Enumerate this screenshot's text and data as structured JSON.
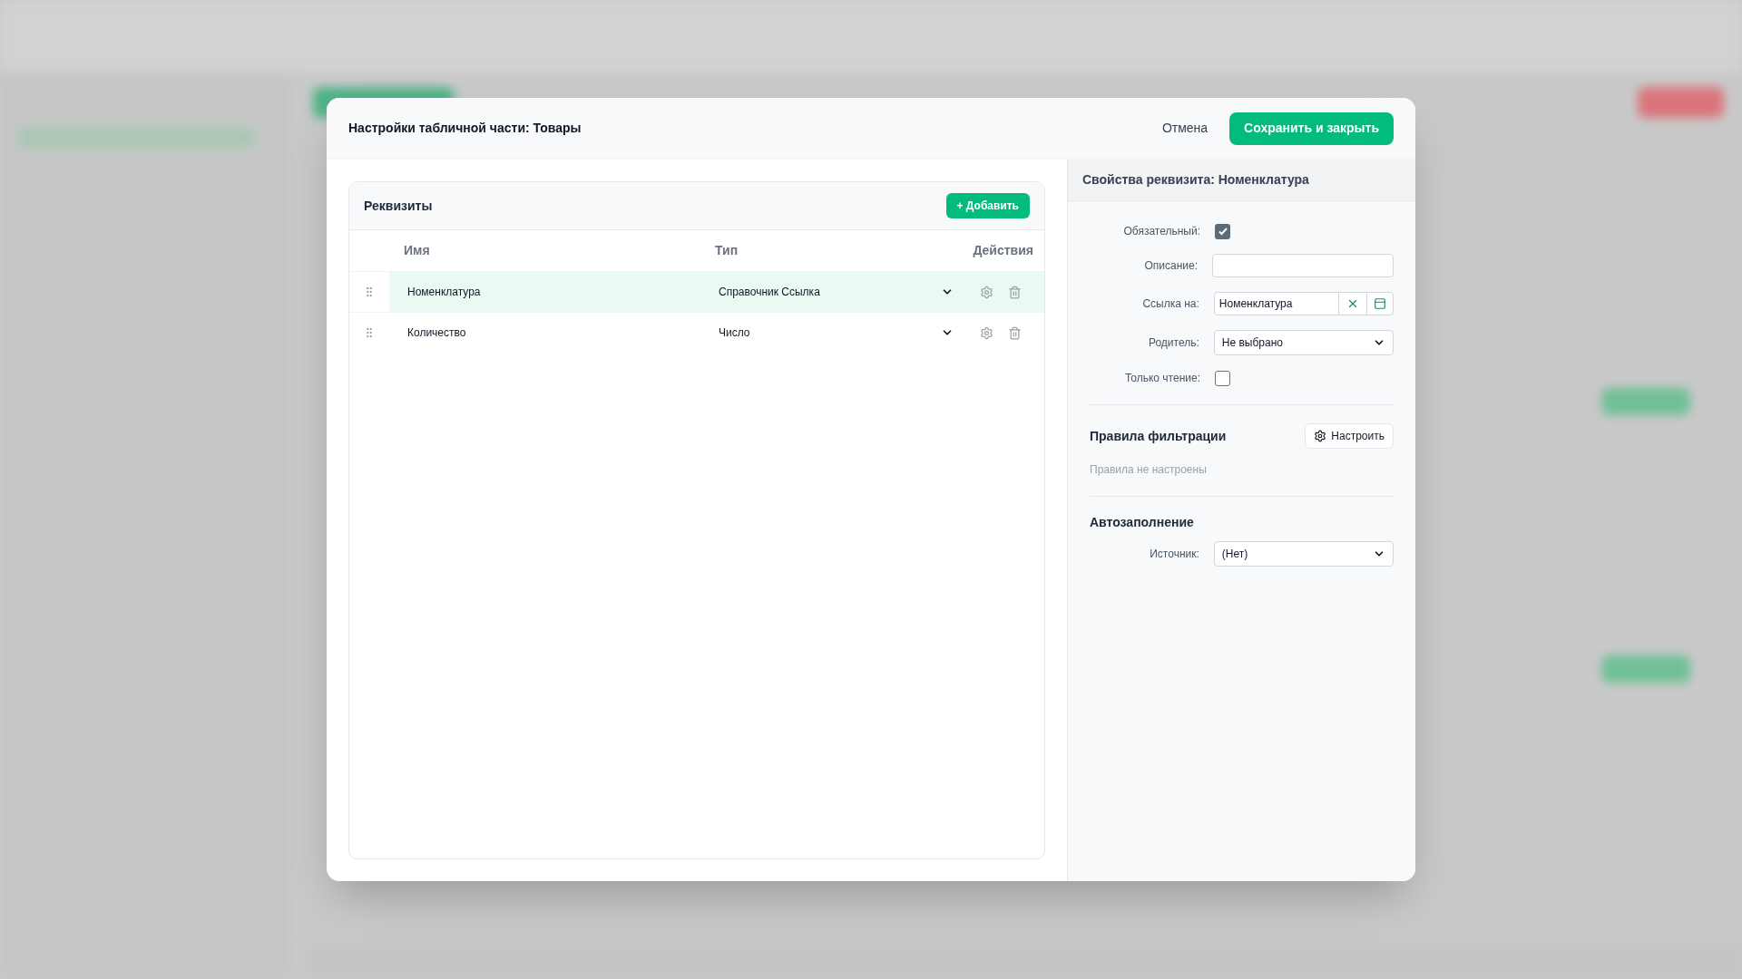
{
  "dialog": {
    "title": "Настройки табличной части: Товары",
    "cancel_button": "Отмена",
    "save_button": "Сохранить и закрыть"
  },
  "attributes": {
    "title": "Реквизиты",
    "add_button": "+ Добавить",
    "columns": [
      "Имя",
      "Тип",
      "Действия"
    ],
    "rows": [
      {
        "name": "Номенклатура",
        "type": "Справочник Ссылка",
        "selected": true
      },
      {
        "name": "Количество",
        "type": "Число",
        "selected": false
      }
    ]
  },
  "properties": {
    "title": "Свойства реквизита: Номенклатура",
    "fields": [
      {
        "kind": "checkbox",
        "label": "Обязательный:",
        "checked": true
      },
      {
        "kind": "text",
        "label": "Описание:"
      },
      {
        "kind": "reference",
        "label": "Ссылка на:",
        "value": "Номенклатура"
      },
      {
        "kind": "select",
        "label": "Родитель:",
        "value": "Не выбрано"
      },
      {
        "kind": "checkbox",
        "label": "Только чтение:",
        "checked": false
      }
    ],
    "filter": {
      "title": "Правила фильтрации",
      "button": "Настроить",
      "note": "Правила не настроены"
    },
    "autofill": {
      "title": "Автозаполнение",
      "fields": [
        {
          "kind": "select",
          "label": "Источник:",
          "value": "(Нет)"
        }
      ]
    }
  }
}
